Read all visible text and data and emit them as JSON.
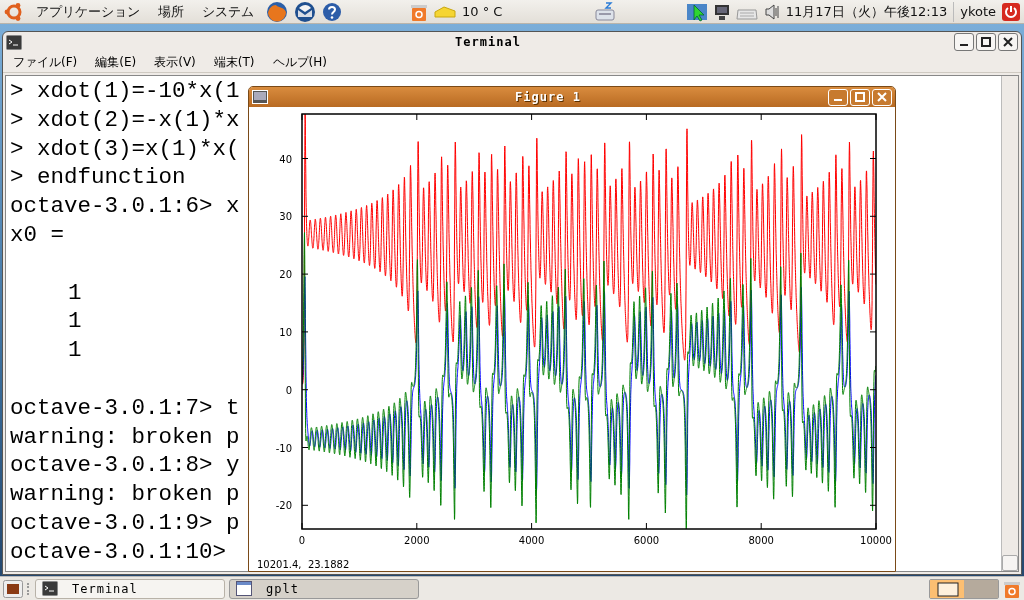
{
  "top_panel": {
    "menus": [
      {
        "label": "アプリケーション"
      },
      {
        "label": "場所"
      },
      {
        "label": "システム"
      }
    ],
    "weather": "10 ° C",
    "clock": "11月17日（火）午後12:13",
    "user": "ykote"
  },
  "terminal": {
    "title": "Terminal",
    "menu": [
      "ファイル(F)",
      "編集(E)",
      "表示(V)",
      "端末(T)",
      "ヘルプ(H)"
    ],
    "blocks": [
      [
        {
          "text": "> xdot(1)=-10*x(1",
          "kind": "input"
        },
        {
          "text": "> xdot(2)=-x(1)*x",
          "kind": "input"
        },
        {
          "text": "> xdot(3)=x(1)*x(",
          "kind": "input"
        },
        {
          "text": "> endfunction",
          "kind": "input"
        },
        {
          "text": "octave-3.0.1:6> x",
          "kind": "input"
        },
        {
          "text": "x0 =",
          "kind": "output"
        }
      ],
      [
        {
          "text": "1",
          "kind": "value"
        },
        {
          "text": "1",
          "kind": "value"
        },
        {
          "text": "1",
          "kind": "value"
        }
      ],
      [
        {
          "text": "octave-3.0.1:7> t",
          "kind": "input"
        },
        {
          "text": "warning: broken p",
          "kind": "output"
        },
        {
          "text": "octave-3.0.1:8> y",
          "kind": "input"
        },
        {
          "text": "warning: broken p",
          "kind": "output"
        },
        {
          "text": "octave-3.0.1:9> p",
          "kind": "input"
        },
        {
          "text": "octave-3.0.1:10>",
          "kind": "input"
        }
      ]
    ]
  },
  "figure": {
    "title": "Figure 1",
    "y_tick_labels": [
      "40",
      "30",
      "20",
      "10",
      "0",
      "-10",
      "-20"
    ],
    "x_tick_labels": [
      "0",
      "2000",
      "4000",
      "6000",
      "8000",
      "10000"
    ],
    "traces": [
      {
        "color": "#ff0000"
      },
      {
        "color": "#0000ff"
      },
      {
        "color": "#008000"
      }
    ],
    "coordinates": "10201.4,  23.1882"
  },
  "taskbar": {
    "tasks": [
      {
        "label": "Terminal",
        "selected": false
      },
      {
        "label": "gplt",
        "selected": true
      }
    ],
    "workspaces": [
      {
        "selected": true
      },
      {
        "selected": false
      }
    ]
  }
}
